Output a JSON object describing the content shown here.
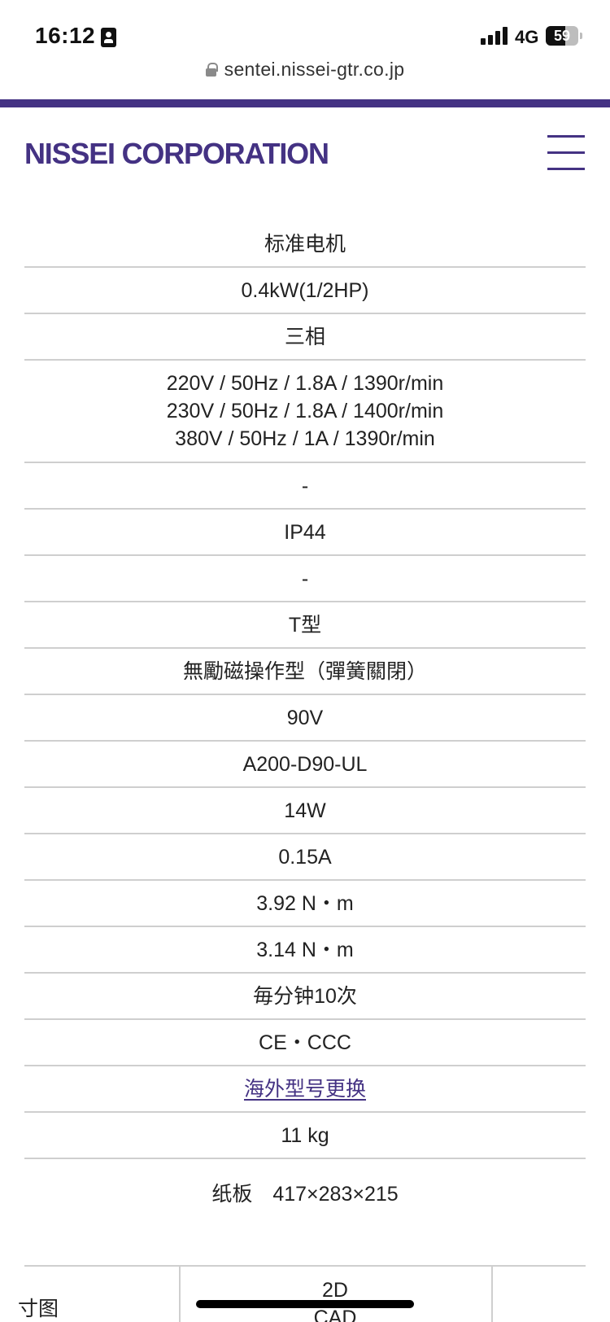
{
  "status_bar": {
    "time": "16:12",
    "network": "4G",
    "battery_level": "59",
    "icons": [
      "id-card-icon",
      "signal-icon",
      "battery-icon"
    ]
  },
  "browser": {
    "url": "sentei.nissei-gtr.co.jp",
    "icons": [
      "lock-icon"
    ]
  },
  "header": {
    "logo": "NISSEI CORPORATION",
    "menu_icon": "hamburger-menu-icon"
  },
  "colors": {
    "brand": "#443283",
    "divider": "#cfcfcf"
  },
  "specs": {
    "motor_type": "标准电机",
    "output": "0.4kW(1/2HP)",
    "phase": "三相",
    "ratings": [
      "220V / 50Hz / 1.8A / 1390r/min",
      "230V / 50Hz / 1.8A / 1400r/min",
      "380V / 50Hz / 1A / 1390r/min"
    ],
    "row5": "-",
    "protection": "IP44",
    "row7": "-",
    "terminal_box": "T型",
    "brake_type": "無勵磁操作型（彈簧關閉）",
    "brake_voltage": "90V",
    "rectifier": "A200-D90-UL",
    "brake_power": "14W",
    "brake_current": "0.15A",
    "static_torque": "3.92 N・m",
    "dynamic_torque": "3.14 N・m",
    "frequency": "毎分钟10次",
    "certifications": "CE・CCC",
    "overseas_link": "海外型号更换",
    "weight": "11 kg",
    "packing": "纸板　417×283×215"
  },
  "drawing_table": {
    "label": "寸图",
    "cad_label_line1": "2D",
    "cad_label_line2": "CAD"
  }
}
